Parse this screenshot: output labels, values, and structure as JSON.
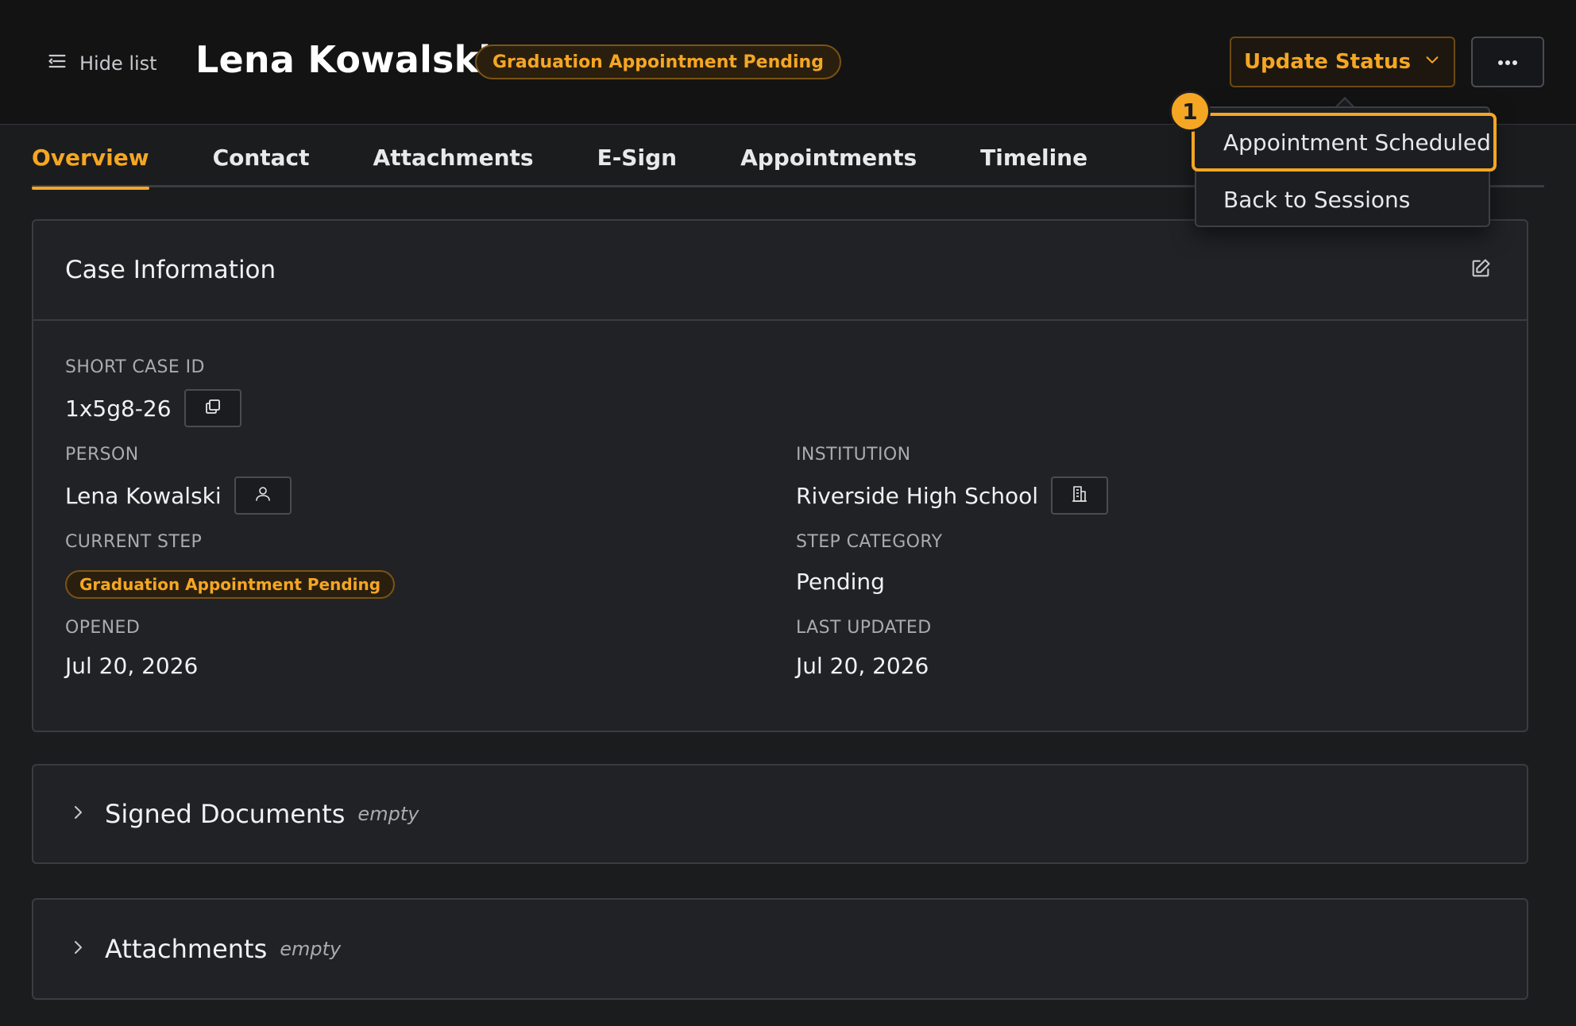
{
  "header": {
    "hide_list_label": "Hide list",
    "person_name": "Lena Kowalski",
    "status_pill": "Graduation Appointment Pending",
    "update_status_label": "Update Status"
  },
  "tabs": [
    {
      "label": "Overview",
      "active": true
    },
    {
      "label": "Contact",
      "active": false
    },
    {
      "label": "Attachments",
      "active": false
    },
    {
      "label": "E-Sign",
      "active": false
    },
    {
      "label": "Appointments",
      "active": false
    },
    {
      "label": "Timeline",
      "active": false
    }
  ],
  "case_info": {
    "title": "Case Information",
    "short_case_id_label": "SHORT CASE ID",
    "short_case_id": "1x5g8-26",
    "person_label": "PERSON",
    "person": "Lena Kowalski",
    "institution_label": "INSTITUTION",
    "institution": "Riverside High School",
    "current_step_label": "CURRENT STEP",
    "current_step": "Graduation Appointment Pending",
    "step_category_label": "STEP CATEGORY",
    "step_category": "Pending",
    "opened_label": "OPENED",
    "opened": "Jul 20, 2026",
    "last_updated_label": "LAST UPDATED",
    "last_updated": "Jul 20, 2026"
  },
  "sections": [
    {
      "title": "Signed Documents",
      "note": "empty"
    },
    {
      "title": "Attachments",
      "note": "empty"
    }
  ],
  "dropdown": {
    "step_number": "1",
    "items": [
      {
        "label": "Appointment Scheduled",
        "highlighted": true
      },
      {
        "label": "Back to Sessions",
        "highlighted": false
      }
    ]
  },
  "colors": {
    "accent": "#f5a623",
    "background": "#1b1c1e",
    "header_bg": "#131314",
    "card_bg": "#212226"
  },
  "icons": [
    "list-icon",
    "chevron-down-icon",
    "more-horizontal-icon",
    "edit-icon",
    "copy-icon",
    "user-icon",
    "building-icon",
    "chevron-right-icon"
  ]
}
